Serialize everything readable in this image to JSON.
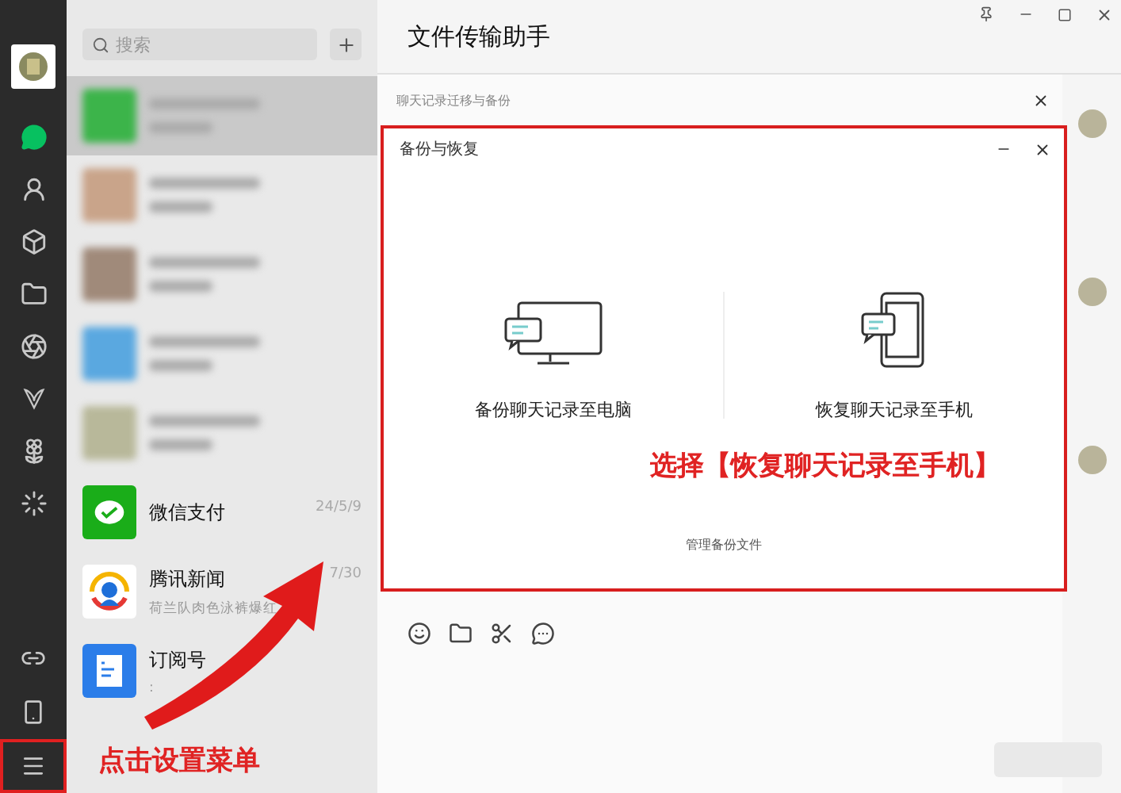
{
  "nav": {
    "items": [
      {
        "kind": "chats",
        "selected": true
      },
      {
        "kind": "contacts",
        "selected": false
      },
      {
        "kind": "favorites",
        "selected": false
      },
      {
        "kind": "files",
        "selected": false
      },
      {
        "kind": "moments",
        "selected": false
      },
      {
        "kind": "channels",
        "selected": false
      },
      {
        "kind": "miniprograms",
        "selected": false
      },
      {
        "kind": "explore",
        "selected": false
      }
    ],
    "bottom": [
      {
        "kind": "link",
        "highlighted": false
      },
      {
        "kind": "phone",
        "highlighted": false
      },
      {
        "kind": "menu",
        "highlighted": true
      }
    ]
  },
  "search": {
    "placeholder": "搜索"
  },
  "chats": [
    {
      "kind": "blurred",
      "selected": true,
      "color": "#3cb44a"
    },
    {
      "kind": "blurred",
      "selected": false,
      "color": "#c9a48a"
    },
    {
      "kind": "blurred",
      "selected": false,
      "color": "#a08a7a"
    },
    {
      "kind": "blurred",
      "selected": false,
      "color": "#5aa8e0"
    },
    {
      "kind": "blurred",
      "selected": false,
      "color": "#b8b89a"
    },
    {
      "kind": "pay",
      "selected": false,
      "name": "微信支付",
      "time": "24/5/9"
    },
    {
      "kind": "news",
      "selected": false,
      "name": "腾讯新闻",
      "time": "7/30",
      "preview": "荷兰队肉色泳裤爆红"
    },
    {
      "kind": "subscriptions",
      "selected": false,
      "name": "订阅号",
      "preview": ":"
    }
  ],
  "chat": {
    "title": "文件传输助手"
  },
  "migrate_dialog": {
    "title": "聊天记录迁移与备份"
  },
  "backup_dialog": {
    "title": "备份与恢复",
    "highlighted": true,
    "options": [
      {
        "kind": "computer",
        "label": "备份聊天记录至电脑"
      },
      {
        "kind": "phone",
        "label": "恢复聊天记录至手机"
      }
    ],
    "link": "管理备份文件"
  },
  "annotations": [
    {
      "kind": "dialog",
      "text": "选择【恢复聊天记录至手机】"
    },
    {
      "kind": "menu",
      "text": "点击设置菜单"
    }
  ]
}
